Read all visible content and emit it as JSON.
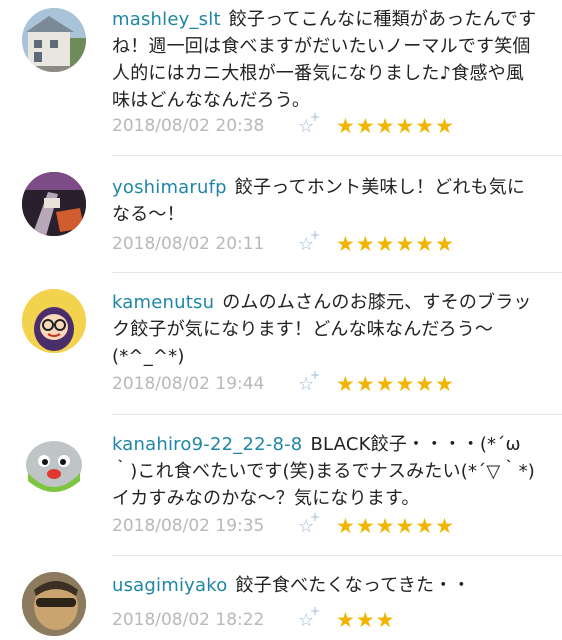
{
  "comments": [
    {
      "user": "mashley_slt",
      "text": "餃子ってこんなに種類があったんですね！週一回は食べますがだいたいノーマルです笑個人的にはカニ大根が一番気になりました♪食感や風味はどんななんだろう。",
      "date": "2018/08/02 20:38",
      "stars": "★★★★★★",
      "add_star": "☆"
    },
    {
      "user": "yoshimarufp",
      "text": "餃子ってホント美味し！どれも気になる〜！",
      "date": "2018/08/02 20:11",
      "stars": "★★★★★★",
      "add_star": "☆"
    },
    {
      "user": "kamenutsu",
      "text": "のムのムさんのお膝元、すそのブラック餃子が気になります！どんな味なんだろう〜(*^_^*)",
      "date": "2018/08/02 19:44",
      "stars": "★★★★★★",
      "add_star": "☆"
    },
    {
      "user": "kanahiro9-22_22-8-8",
      "text": "BLACK餃子・・・・(*´ω｀)これ食べたいです(笑)まるでナスみたい(*´▽｀*)イカすみなのかな〜？気になります。",
      "date": "2018/08/02 19:35",
      "stars": "★★★★★★",
      "add_star": "☆"
    },
    {
      "user": "usagimiyako",
      "text": "餃子食べたくなってきた・・",
      "date": "2018/08/02 18:22",
      "stars": "★★★",
      "add_star": "☆"
    }
  ]
}
